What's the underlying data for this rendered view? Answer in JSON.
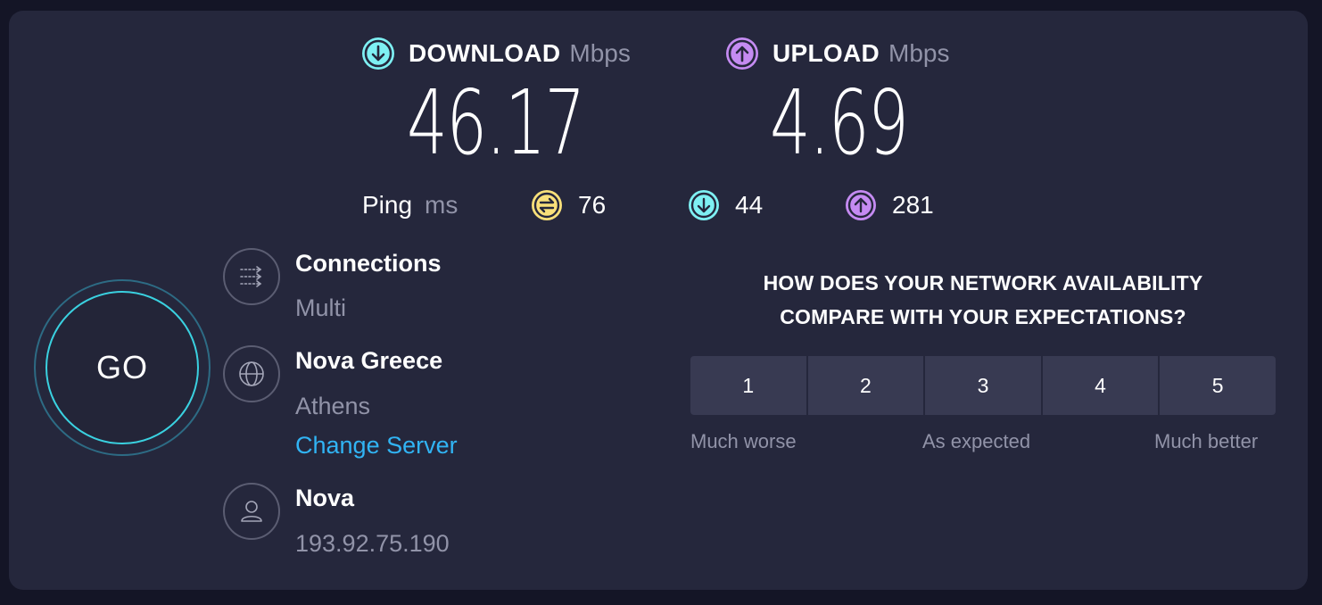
{
  "download": {
    "label": "DOWNLOAD",
    "unit": "Mbps",
    "value": "46.17",
    "icon": "arrow-down-circle-icon",
    "color": "#7ef0f3"
  },
  "upload": {
    "label": "UPLOAD",
    "unit": "Mbps",
    "value": "4.69",
    "icon": "arrow-up-circle-icon",
    "color": "#c58bf2"
  },
  "ping": {
    "label": "Ping",
    "unit": "ms",
    "idle": {
      "value": "76",
      "icon": "ping-idle-icon",
      "color": "#f9e07a"
    },
    "download": {
      "value": "44",
      "icon": "arrow-down-circle-icon",
      "color": "#7ef0f3"
    },
    "upload": {
      "value": "281",
      "icon": "arrow-up-circle-icon",
      "color": "#c58bf2"
    }
  },
  "go_button": {
    "label": "GO"
  },
  "connections": {
    "title": "Connections",
    "value": "Multi",
    "icon": "connections-icon"
  },
  "server": {
    "title": "Nova Greece",
    "location": "Athens",
    "change_label": "Change Server",
    "icon": "globe-icon"
  },
  "provider": {
    "title": "Nova",
    "ip": "193.92.75.190",
    "icon": "user-icon"
  },
  "survey": {
    "question_line1": "HOW DOES YOUR NETWORK AVAILABILITY",
    "question_line2": "COMPARE WITH YOUR EXPECTATIONS?",
    "options": [
      "1",
      "2",
      "3",
      "4",
      "5"
    ],
    "label_low": "Much worse",
    "label_mid": "As expected",
    "label_high": "Much better"
  }
}
